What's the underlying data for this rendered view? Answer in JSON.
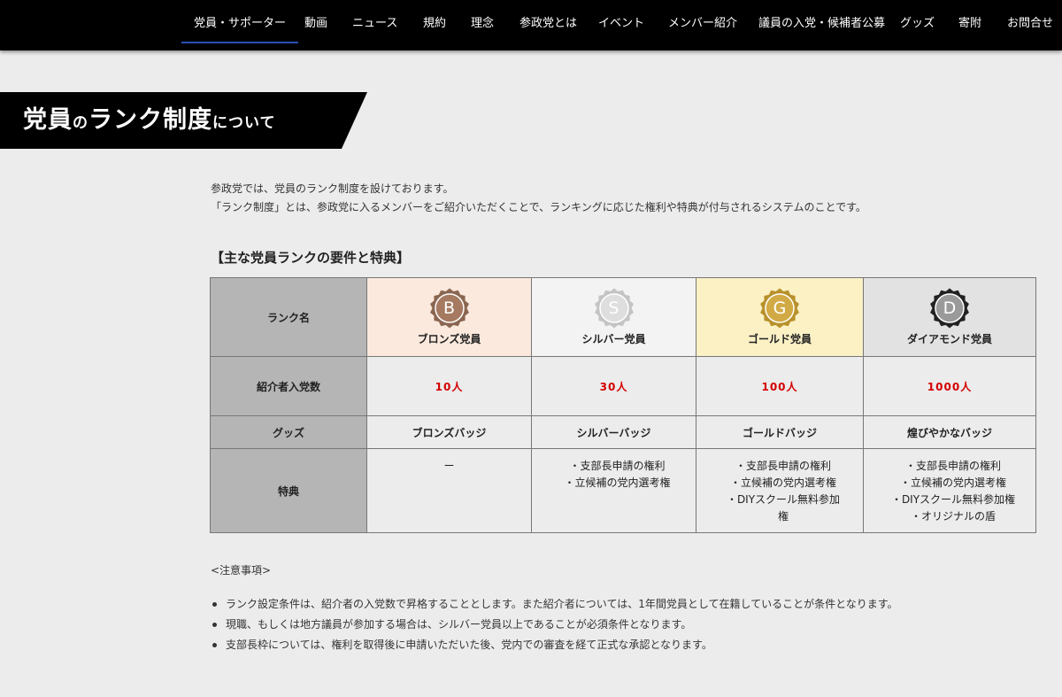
{
  "nav": {
    "items": [
      "党員・サポーター",
      "動画",
      "ニュース",
      "規約",
      "理念",
      "参政党とは",
      "イベント",
      "メンバー紹介",
      "議員の入党・候補者公募",
      "グッズ",
      "寄附",
      "お問合せ"
    ],
    "active_index": 0,
    "accent_color": "#2a4fb8"
  },
  "banner": {
    "part1": "党員",
    "part2": "の",
    "part3": "ランク制度",
    "part4": "について"
  },
  "intro": {
    "line1": "参政党では、党員のランク制度を設けております。",
    "line2": "「ランク制度」とは、参政党に入るメンバーをご紹介いただくことで、ランキングに応じた権利や特典が付与されるシステムのことです。"
  },
  "section_heading": "【主な党員ランクの要件と特典】",
  "table": {
    "row_headers": {
      "rank": "ランク名",
      "referrals": "紹介者入党数",
      "goods": "グッズ",
      "benefits": "特典"
    },
    "ranks": [
      {
        "letter": "B",
        "name": "ブロンズ党員",
        "count": "10人",
        "goods": "ブロンズバッジ",
        "benefits": [],
        "benefit_empty": "ー",
        "bg": "#fbe9dd",
        "medal_outer": "#8a6651",
        "medal_inner": "#a57a60",
        "icon": "bronze-medal-icon"
      },
      {
        "letter": "S",
        "name": "シルバー党員",
        "count": "30人",
        "goods": "シルバーバッジ",
        "benefits": [
          "・支部長申請の権利",
          "・立候補の党内選考権"
        ],
        "bg": "#f3f3f3",
        "medal_outer": "#c4c4c4",
        "medal_inner": "#dedede",
        "icon": "silver-medal-icon"
      },
      {
        "letter": "G",
        "name": "ゴールド党員",
        "count": "100人",
        "goods": "ゴールドバッジ",
        "benefits": [
          "・支部長申請の権利",
          "・立候補の党内選考権",
          "・DIYスクール無料参加",
          "権"
        ],
        "bg": "#fbf1c5",
        "medal_outer": "#b8912c",
        "medal_inner": "#d2aa45",
        "icon": "gold-medal-icon"
      },
      {
        "letter": "D",
        "name": "ダイアモンド党員",
        "count": "1000人",
        "goods": "煌びやかなバッジ",
        "benefits": [
          "・支部長申請の権利",
          "・立候補の党内選考権",
          "・DIYスクール無料参加権",
          "・オリジナルの盾"
        ],
        "bg": "#e2e2e2",
        "medal_outer": "#222222",
        "medal_inner": "#9a9a9a",
        "icon": "diamond-medal-icon"
      }
    ]
  },
  "notes": {
    "title": "<注意事項>",
    "items": [
      "ランク設定条件は、紹介者の入党数で昇格することとします。また紹介者については、1年間党員として在籍していることが条件となります。",
      "現職、もしくは地方議員が参加する場合は、シルバー党員以上であることが必須条件となります。",
      "支部長枠については、権利を取得後に申請いただいた後、党内での審査を経て正式な承認となります。"
    ]
  },
  "colors": {
    "count_red": "#d40000",
    "row_header_bg": "#b5b5b5",
    "page_bg": "#ececec"
  }
}
